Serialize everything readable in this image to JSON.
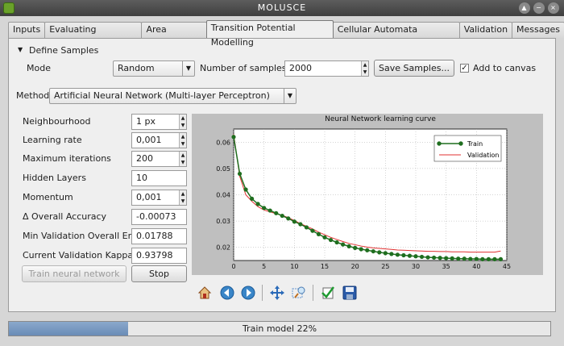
{
  "window": {
    "title": "MOLUSCE"
  },
  "tabs": [
    {
      "label": "Inputs"
    },
    {
      "label": "Evaluating correlation"
    },
    {
      "label": "Area Changes"
    },
    {
      "label": "Transition Potential Modelling"
    },
    {
      "label": "Cellular Automata Simulation"
    },
    {
      "label": "Validation"
    },
    {
      "label": "Messages"
    }
  ],
  "define_samples": {
    "header": "Define Samples",
    "mode_label": "Mode",
    "mode_value": "Random",
    "samples_label": "Number of samples",
    "samples_value": "2000",
    "save_button": "Save Samples...",
    "add_canvas_label": "Add to canvas",
    "add_canvas_checked": true
  },
  "method": {
    "label": "Method",
    "value": "Artificial Neural Network (Multi-layer Perceptron)"
  },
  "params": {
    "neighbourhood_label": "Neighbourhood",
    "neighbourhood_value": "1 px",
    "learning_rate_label": "Learning rate",
    "learning_rate_value": "0,001",
    "max_iter_label": "Maximum iterations",
    "max_iter_value": "200",
    "hidden_label": "Hidden Layers",
    "hidden_value": "10",
    "momentum_label": "Momentum",
    "momentum_value": "0,001",
    "overall_acc_label": "Δ Overall Accuracy",
    "overall_acc_value": "-0.00073",
    "min_val_label": "Min Validation Overall Error",
    "min_val_value": "0.01788",
    "kappa_label": "Current Validation Kappa",
    "kappa_value": "0.93798",
    "train_button": "Train neural network",
    "stop_button": "Stop"
  },
  "progress": {
    "text": "Train model 22%",
    "fraction": 0.22
  },
  "toolbar_icons": [
    "home-icon",
    "back-icon",
    "forward-icon",
    "pan-icon",
    "zoom-icon",
    "configure-icon",
    "save-icon"
  ],
  "chart_data": {
    "type": "line",
    "title": "Neural Network learning curve",
    "xlabel": "",
    "ylabel": "",
    "xlim": [
      0,
      45
    ],
    "ylim": [
      0.015,
      0.065
    ],
    "xticks": [
      0,
      5,
      10,
      15,
      20,
      25,
      30,
      35,
      40,
      45
    ],
    "yticks": [
      0.02,
      0.03,
      0.04,
      0.05,
      0.06
    ],
    "ytick_labels": [
      "0.02",
      "0.03",
      "0.04",
      "0.05",
      "0.06"
    ],
    "grid": true,
    "legend": "top-right",
    "series": [
      {
        "name": "Train",
        "color": "#1f6e1f",
        "marker": "circle",
        "x": [
          0,
          1,
          2,
          3,
          4,
          5,
          6,
          7,
          8,
          9,
          10,
          11,
          12,
          13,
          14,
          15,
          16,
          17,
          18,
          19,
          20,
          21,
          22,
          23,
          24,
          25,
          26,
          27,
          28,
          29,
          30,
          31,
          32,
          33,
          34,
          35,
          36,
          37,
          38,
          39,
          40,
          41,
          42,
          43,
          44
        ],
        "values": [
          0.062,
          0.048,
          0.042,
          0.0385,
          0.0365,
          0.035,
          0.034,
          0.033,
          0.032,
          0.031,
          0.0298,
          0.0288,
          0.0276,
          0.0263,
          0.025,
          0.0238,
          0.0228,
          0.0219,
          0.0211,
          0.0204,
          0.0198,
          0.0193,
          0.0189,
          0.0185,
          0.0181,
          0.0178,
          0.0175,
          0.0172,
          0.017,
          0.0168,
          0.0166,
          0.0164,
          0.0162,
          0.0161,
          0.016,
          0.0159,
          0.0158,
          0.0157,
          0.0157,
          0.0156,
          0.0156,
          0.0155,
          0.0155,
          0.0155,
          0.0155
        ]
      },
      {
        "name": "Validation",
        "color": "#e03030",
        "marker": "none",
        "x": [
          0,
          1,
          2,
          3,
          4,
          5,
          6,
          7,
          8,
          9,
          10,
          11,
          12,
          13,
          14,
          15,
          16,
          17,
          18,
          19,
          20,
          21,
          22,
          23,
          24,
          25,
          26,
          27,
          28,
          29,
          30,
          31,
          32,
          33,
          34,
          35,
          36,
          37,
          38,
          39,
          40,
          41,
          42,
          43,
          44
        ],
        "values": [
          0.063,
          0.047,
          0.04,
          0.0375,
          0.0355,
          0.0342,
          0.0335,
          0.0328,
          0.0322,
          0.0313,
          0.0302,
          0.029,
          0.028,
          0.027,
          0.0258,
          0.0248,
          0.0238,
          0.023,
          0.0222,
          0.0215,
          0.021,
          0.0205,
          0.0201,
          0.0198,
          0.0196,
          0.0194,
          0.0192,
          0.019,
          0.0189,
          0.0188,
          0.0187,
          0.0186,
          0.0185,
          0.0185,
          0.0184,
          0.0184,
          0.0183,
          0.0183,
          0.0183,
          0.0182,
          0.0182,
          0.0182,
          0.0182,
          0.0182,
          0.0186
        ]
      }
    ]
  }
}
